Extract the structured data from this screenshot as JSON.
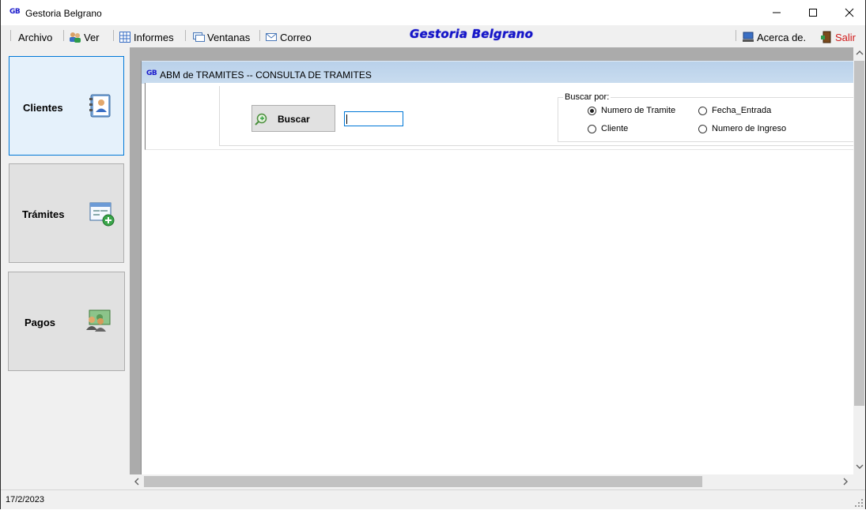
{
  "window": {
    "title": "Gestoria Belgrano",
    "logo_text": "GB",
    "controls": [
      "minimize",
      "maximize",
      "close"
    ]
  },
  "menu": {
    "items": [
      {
        "label": "Archivo",
        "icon": ""
      },
      {
        "label": "Ver",
        "icon": "users-icon"
      },
      {
        "label": "Informes",
        "icon": "report-grid-icon"
      },
      {
        "label": "Ventanas",
        "icon": "windows-icon"
      },
      {
        "label": "Correo",
        "icon": "envelope-icon"
      }
    ],
    "brand": "Gestoria Belgrano",
    "acerca": "Acerca de.",
    "salir": "Salir"
  },
  "nav": {
    "items": [
      {
        "label": "Clientes",
        "icon": "address-book-icon",
        "active": true
      },
      {
        "label": "Trámites",
        "icon": "form-add-icon",
        "active": false
      },
      {
        "label": "Pagos",
        "icon": "payments-icon",
        "active": false
      }
    ]
  },
  "child_window": {
    "logo_text": "GB",
    "title": "ABM de TRAMITES -- CONSULTA DE TRAMITES",
    "search_button": "Buscar",
    "search_value": "",
    "group_label": "Buscar por:",
    "radios": [
      {
        "label": "Numero de Tramite",
        "checked": true
      },
      {
        "label": "Fecha_Entrada",
        "checked": false
      },
      {
        "label": "Cliente",
        "checked": false
      },
      {
        "label": "Numero de Ingreso",
        "checked": false
      }
    ]
  },
  "status": {
    "date": "17/2/2023"
  },
  "colors": {
    "brand_blue": "#1515c8",
    "salir_red": "#d11a1a",
    "mdi_background": "#ababab",
    "child_titlebar": "#bcd3eb",
    "active_nav": "#e5f1fb"
  }
}
